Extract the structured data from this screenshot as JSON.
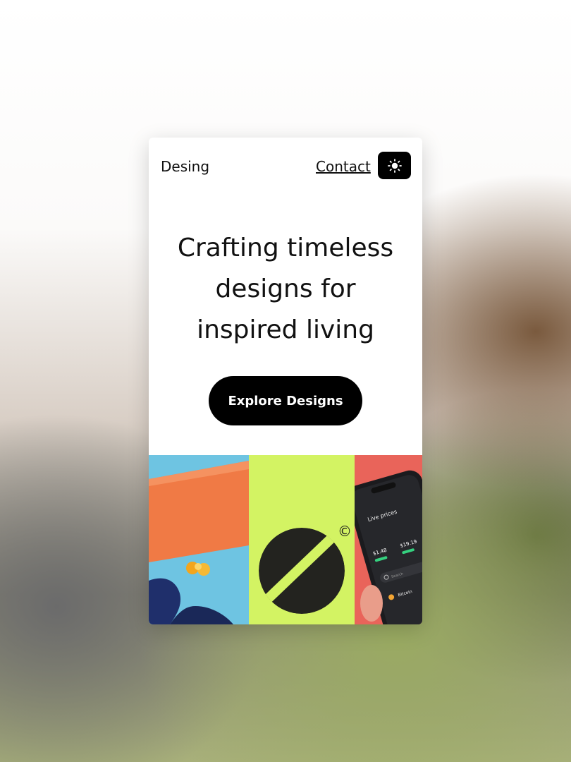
{
  "header": {
    "brand": "Desing",
    "contact_label": "Contact",
    "theme_toggle_icon": "sun-icon"
  },
  "hero": {
    "title": "Crafting timeless designs for inspired living",
    "cta_label": "Explore Designs"
  },
  "gallery": {
    "tiles": [
      {
        "name": "portrait-orange-tile",
        "background": "#6ec4e2"
      },
      {
        "name": "logo-mark-tile",
        "background": "#d3f363",
        "symbol": "©"
      },
      {
        "name": "phone-app-tile",
        "background": "#e9645a",
        "phone_heading": "Live prices",
        "phone_values": [
          "$1.48",
          "$19.19"
        ],
        "phone_search": "Search",
        "phone_item": "Bitcoin"
      }
    ]
  },
  "colors": {
    "accent": "#000000",
    "card_background": "#ffffff"
  }
}
